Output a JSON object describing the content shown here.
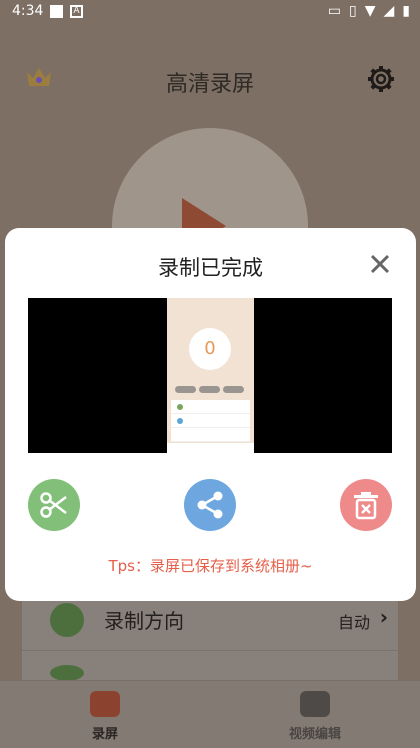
{
  "status_bar": {
    "time": "4:34"
  },
  "app": {
    "title": "高清录屏",
    "settings_row": {
      "label": "录制方向",
      "value": "自动"
    }
  },
  "nav": {
    "record": "录屏",
    "edit": "视频编辑"
  },
  "dialog": {
    "title": "录制已完成",
    "preview": {
      "counter": "0"
    },
    "tips": "Tps：录屏已保存到系统相册~"
  },
  "colors": {
    "cut": "#82c07a",
    "share": "#6ea7e0",
    "delete": "#ee8a8a",
    "tips": "#e5604a"
  },
  "icons": {
    "crown": "crown-icon",
    "settings": "gear-icon",
    "close": "close-icon",
    "cut": "scissors-icon",
    "share": "share-icon",
    "delete": "trash-icon"
  }
}
